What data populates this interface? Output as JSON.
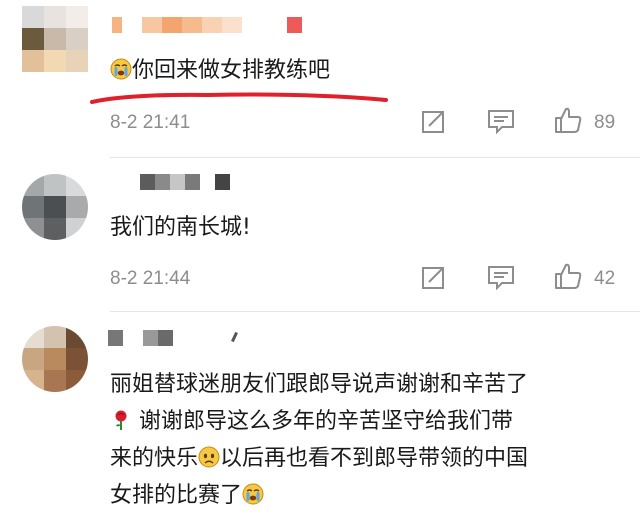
{
  "comments": [
    {
      "text": "你回来做女排教练吧",
      "time": "8-2 21:41",
      "likes": "89"
    },
    {
      "text": "我们的南长城!",
      "time": "8-2 21:44",
      "likes": "42"
    },
    {
      "lines": [
        "丽姐替球迷朋友们跟郎导说声谢谢和辛苦了",
        "谢谢郎导这么多年的辛苦坚守给我们带",
        "来的快乐",
        "以后再也看不到郎导带领的中国",
        "女排的比赛了"
      ]
    }
  ],
  "icons": {
    "crying": "loudly-crying-face-icon",
    "rose": "rose-icon",
    "sad": "sad-face-icon",
    "forward": "share-icon",
    "comment": "comment-icon",
    "like": "thumbs-up-icon"
  },
  "colors": {
    "meta": "#8d8d8d",
    "text": "#1a1a1a",
    "underline": "#e0202a"
  }
}
